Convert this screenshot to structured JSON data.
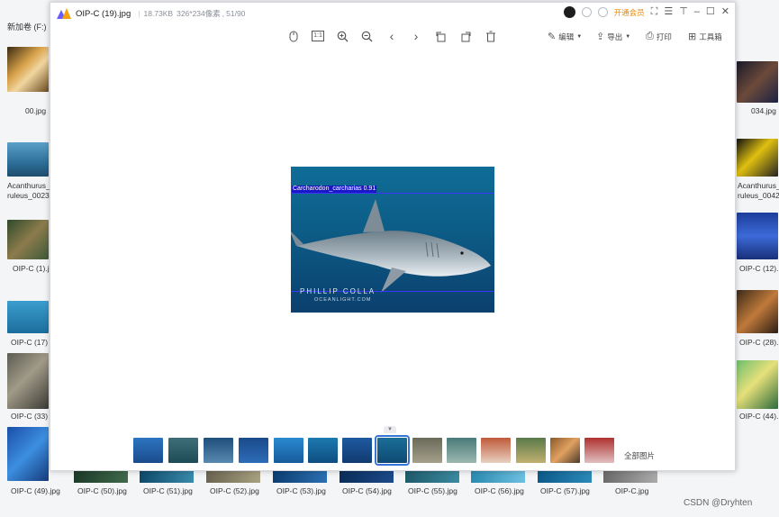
{
  "explorer": {
    "drive_label": "新加卷 (F:)",
    "left_captions": [
      "00.jpg",
      "Acanthurus_",
      "ruleus_0023",
      "OIP-C (1).j",
      "OIP-C (17)",
      "OIP-C (33)"
    ],
    "right_captions": [
      "034.jpg",
      "Acanthurus_",
      "ruleus_0042",
      "OIP-C (12).",
      "OIP-C (28).",
      "OIP-C (44)."
    ],
    "bottom_captions": [
      "OIP-C (49).jpg",
      "OIP-C (50).jpg",
      "OIP-C (51).jpg",
      "OIP-C (52).jpg",
      "OIP-C (53).jpg",
      "OIP-C (54).jpg",
      "OIP-C (55).jpg",
      "OIP-C (56).jpg",
      "OIP-C (57).jpg",
      "OIP-C.jpg"
    ]
  },
  "viewer": {
    "filename": "OIP-C (19).jpg",
    "size": "18.73KB",
    "dimensions": "326*234像素",
    "position": "51/90",
    "vip_label": "开通会员",
    "toolbar": {
      "edit_label": "编辑",
      "export_label": "导出",
      "print_label": "打印",
      "toolbox_label": "工具箱",
      "actual_size_label": "1:1"
    },
    "image": {
      "detection_label": "Carcharodon_carcharias  0.91",
      "watermark_line1": "PHILLIP COLLA",
      "watermark_line2": "OCEANLIGHT.COM"
    },
    "filmstrip": {
      "all_pictures_label": "全部图片",
      "selected_index": 7
    }
  },
  "footer": {
    "watermark": "CSDN @Dryhten"
  },
  "colors": {
    "vip": "#e88a00",
    "selection": "#3575d8",
    "detection_box": "#3a35ff"
  }
}
